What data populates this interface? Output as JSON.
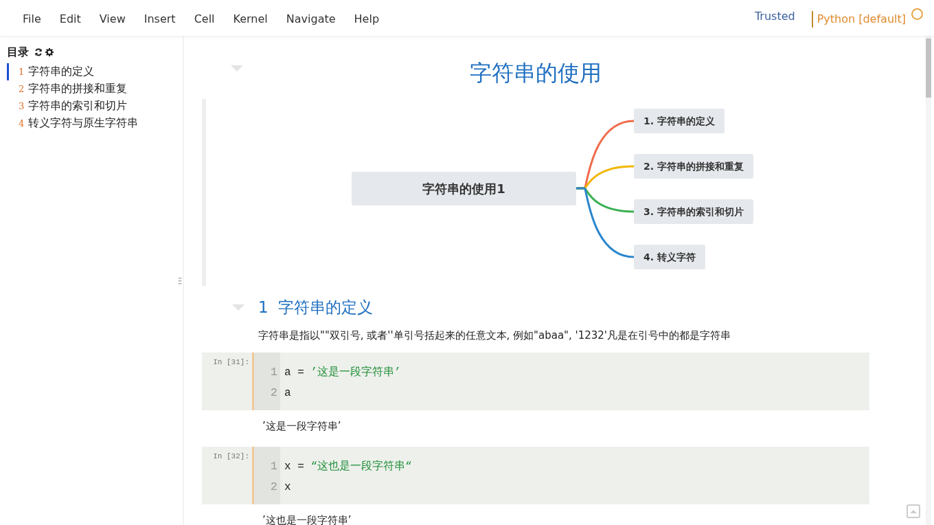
{
  "menu": [
    "File",
    "Edit",
    "View",
    "Insert",
    "Cell",
    "Kernel",
    "Navigate",
    "Help"
  ],
  "trusted": "Trusted",
  "kernel": {
    "name": "Python [default]",
    "busy": false
  },
  "toc": {
    "title": "目录",
    "items": [
      {
        "number": "1",
        "label": "字符串的定义",
        "selected": true
      },
      {
        "number": "2",
        "label": "字符串的拼接和重复",
        "selected": false
      },
      {
        "number": "3",
        "label": "字符串的索引和切片",
        "selected": false
      },
      {
        "number": "4",
        "label": "转义字符与原生字符串",
        "selected": false
      }
    ]
  },
  "cells": [
    {
      "kind": "title",
      "text": "字符串的使用"
    },
    {
      "kind": "mindmap",
      "root": "字符串的使用1",
      "branches": [
        {
          "label": "1. 字符串的定义",
          "color": "#ef6c4c"
        },
        {
          "label": "2. 字符串的拼接和重复",
          "color": "#f2b705"
        },
        {
          "label": "3. 字符串的索引和切片",
          "color": "#3cb054"
        },
        {
          "label": "4. 转义字符",
          "color": "#2b86cc"
        }
      ]
    },
    {
      "kind": "heading",
      "number": "1",
      "text": "字符串的定义"
    },
    {
      "kind": "markdown",
      "text": "字符串是指以\"\"双引号, 或者''单引号括起来的任意文本, 例如\"abaa\", '1232'凡是在引号中的都是字符串"
    },
    {
      "kind": "code",
      "prompt": "In [31]:",
      "lines": [
        {
          "number": "1",
          "parts": [
            {
              "kind": "plain",
              "text": "a = "
            },
            {
              "kind": "string",
              "text": "’这是一段字符串’"
            }
          ]
        },
        {
          "number": "2",
          "parts": [
            {
              "kind": "plain",
              "text": "a"
            }
          ]
        }
      ]
    },
    {
      "kind": "output",
      "text": "’这是一段字符串’"
    },
    {
      "kind": "code",
      "prompt": "In [32]:",
      "lines": [
        {
          "number": "1",
          "parts": [
            {
              "kind": "plain",
              "text": "x = "
            },
            {
              "kind": "string",
              "text": "“这也是一段字符串“"
            }
          ]
        },
        {
          "number": "2",
          "parts": [
            {
              "kind": "plain",
              "text": "x"
            }
          ]
        }
      ]
    },
    {
      "kind": "output",
      "text": "’这也是一段字符串’"
    }
  ]
}
